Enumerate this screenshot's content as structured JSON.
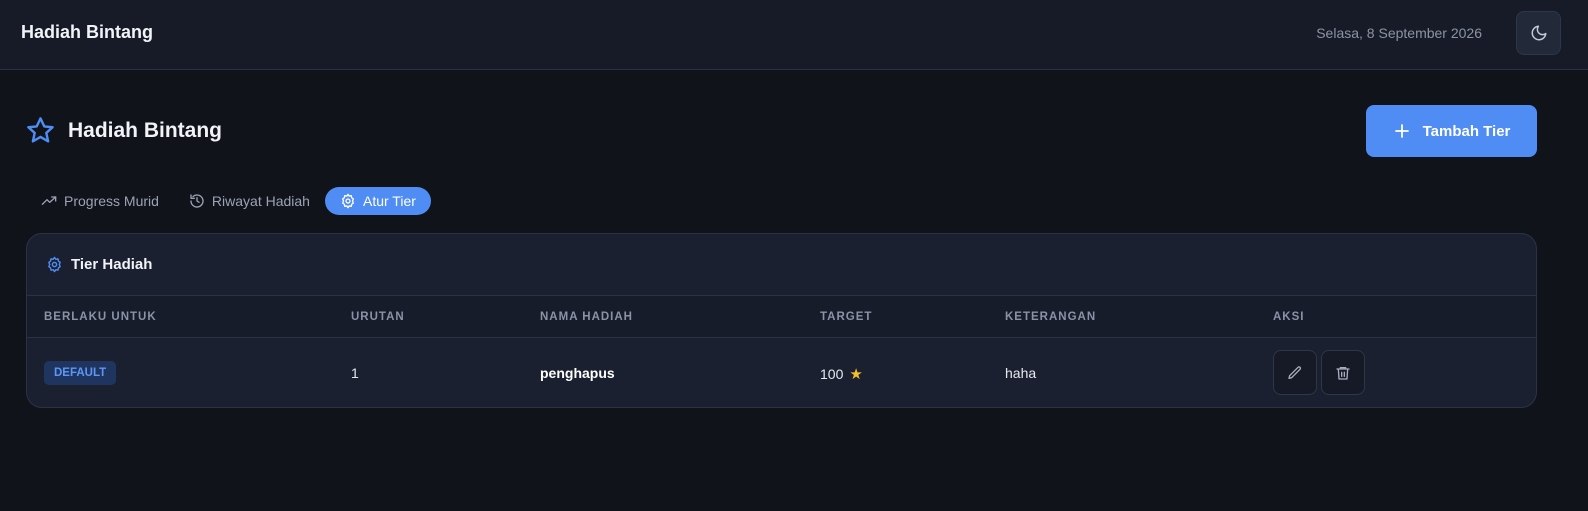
{
  "topbar": {
    "title": "Hadiah Bintang",
    "date": "Selasa, 8 September 2026",
    "theme_icon": "moon-icon"
  },
  "page": {
    "title": "Hadiah Bintang",
    "title_icon": "star-outline-icon",
    "add_button_label": "Tambah Tier"
  },
  "tabs": [
    {
      "label": "Progress Murid",
      "icon": "trending-up-icon",
      "active": false
    },
    {
      "label": "Riwayat Hadiah",
      "icon": "history-icon",
      "active": false
    },
    {
      "label": "Atur Tier",
      "icon": "gear-icon",
      "active": true
    }
  ],
  "card": {
    "title": "Tier Hadiah",
    "icon": "gear-icon"
  },
  "table": {
    "headers": [
      "BERLAKU UNTUK",
      "URUTAN",
      "NAMA HADIAH",
      "TARGET",
      "KETERANGAN",
      "AKSI"
    ],
    "rows": [
      {
        "berlaku": "DEFAULT",
        "urutan": "1",
        "nama": "penghapus",
        "target": "100",
        "keterangan": "haha"
      }
    ]
  },
  "colors": {
    "accent": "#4f8cf3",
    "background": "#10131a",
    "surface": "#1a2030",
    "star": "#f5bf2a"
  }
}
